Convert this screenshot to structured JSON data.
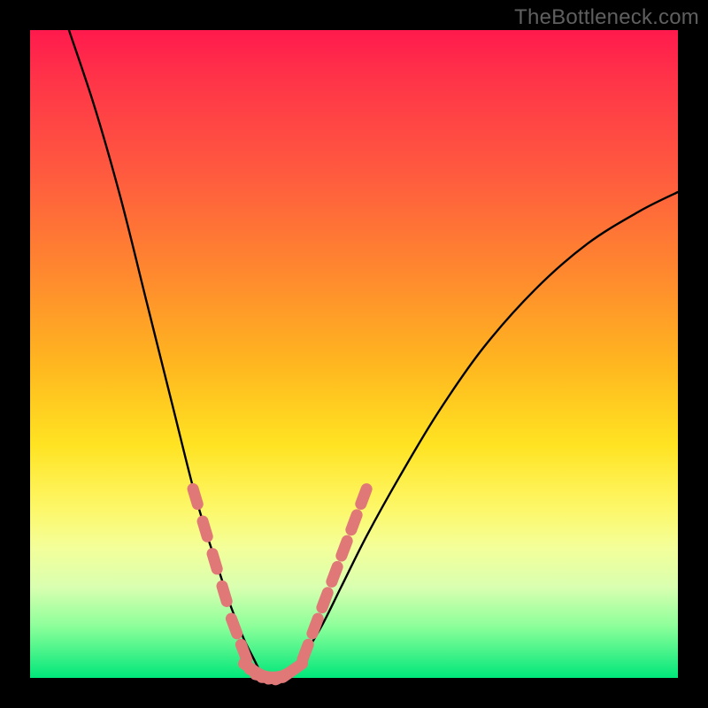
{
  "watermark": "TheBottleneck.com",
  "chart_data": {
    "type": "line",
    "title": "",
    "xlabel": "",
    "ylabel": "",
    "xlim": [
      0,
      100
    ],
    "ylim": [
      0,
      100
    ],
    "gradient_colors": {
      "top": "#ff1a4d",
      "mid_upper": "#ff8a2e",
      "mid": "#ffe322",
      "mid_lower": "#f3ff9a",
      "bottom": "#00e77a"
    },
    "series": [
      {
        "name": "left-curve",
        "stroke": "#000000",
        "x": [
          6,
          10,
          14,
          18,
          22,
          25,
          27,
          29,
          31,
          33,
          34.5,
          36
        ],
        "values": [
          100,
          88,
          74,
          58,
          42,
          30,
          23,
          17,
          11,
          6,
          3,
          0
        ]
      },
      {
        "name": "right-curve",
        "stroke": "#000000",
        "x": [
          40,
          42,
          45,
          48,
          52,
          57,
          63,
          70,
          78,
          86,
          94,
          100
        ],
        "values": [
          0,
          3,
          8,
          14,
          22,
          31,
          41,
          51,
          60,
          67,
          72,
          75
        ]
      },
      {
        "name": "bead-overlay-left",
        "stroke": "#e07878",
        "style": "beads",
        "x": [
          25.5,
          27,
          28.5,
          30,
          31.5,
          33
        ],
        "values": [
          28,
          23,
          18,
          13,
          8,
          4
        ]
      },
      {
        "name": "bead-overlay-bottom",
        "stroke": "#e07878",
        "style": "beads",
        "x": [
          34,
          35,
          36,
          37,
          38,
          39,
          40,
          41
        ],
        "values": [
          1.5,
          0.8,
          0.3,
          0.1,
          0.1,
          0.3,
          0.8,
          1.5
        ]
      },
      {
        "name": "bead-overlay-right",
        "stroke": "#e07878",
        "style": "beads",
        "x": [
          42.5,
          44,
          45.5,
          47,
          48.5,
          50,
          51.5
        ],
        "values": [
          4,
          8,
          12,
          16,
          20,
          24,
          28
        ]
      }
    ]
  }
}
